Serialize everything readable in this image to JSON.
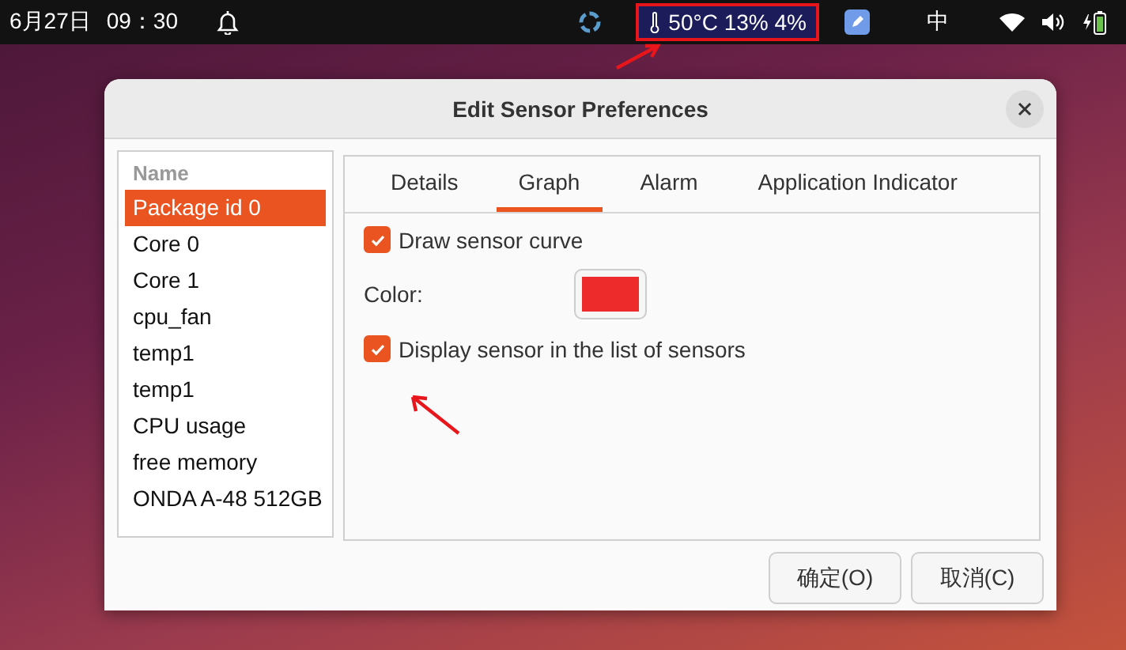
{
  "top_bar": {
    "date": "6月27日",
    "time": "09：30",
    "indicator": "50°C 13% 4%",
    "input_method": "中"
  },
  "dialog": {
    "title": "Edit Sensor Preferences",
    "sensor_list": {
      "header": "Name",
      "items": [
        {
          "label": "Package id 0",
          "selected": true
        },
        {
          "label": "Core 0",
          "selected": false
        },
        {
          "label": "Core 1",
          "selected": false
        },
        {
          "label": "cpu_fan",
          "selected": false
        },
        {
          "label": "temp1",
          "selected": false
        },
        {
          "label": "temp1",
          "selected": false
        },
        {
          "label": "CPU usage",
          "selected": false
        },
        {
          "label": "free memory",
          "selected": false
        },
        {
          "label": "ONDA A-48 512GB",
          "selected": false
        }
      ]
    },
    "tabs": [
      {
        "label": "Details",
        "selected": false
      },
      {
        "label": "Graph",
        "selected": true
      },
      {
        "label": "Alarm",
        "selected": false
      },
      {
        "label": "Application Indicator",
        "selected": false
      }
    ],
    "options": [
      {
        "kind": "checkbox",
        "label": "Draw sensor curve",
        "checked": true
      },
      {
        "kind": "color",
        "label": "Color:",
        "color": "#ee2b2b"
      },
      {
        "kind": "checkbox",
        "label": "Display sensor in the list of sensors",
        "checked": true
      }
    ],
    "buttons": [
      "确定(O)",
      "取消(C)"
    ]
  }
}
